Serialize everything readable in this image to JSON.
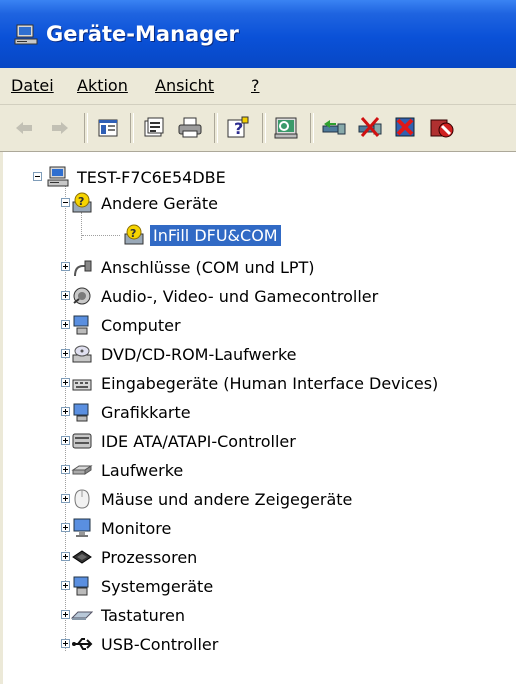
{
  "window": {
    "title": "Geräte-Manager",
    "title_bar_color": "#0a51d8"
  },
  "menu": {
    "items": [
      {
        "label": "Datei",
        "accel_key": "D"
      },
      {
        "label": "Aktion",
        "accel_key": "k"
      },
      {
        "label": "Ansicht",
        "accel_key": "A"
      },
      {
        "label": "?",
        "accel_key": "?"
      }
    ]
  },
  "toolbar": {
    "buttons": [
      {
        "icon": "back-arrow-icon",
        "enabled": false
      },
      {
        "icon": "forward-arrow-icon",
        "enabled": false
      },
      {
        "icon": "console-tree-icon",
        "enabled": true
      },
      {
        "icon": "properties-icon",
        "enabled": true
      },
      {
        "icon": "print-icon",
        "enabled": true
      },
      {
        "icon": "help-icon",
        "enabled": true
      },
      {
        "icon": "scan-hardware-icon",
        "enabled": true
      },
      {
        "icon": "update-driver-icon",
        "enabled": true
      },
      {
        "icon": "uninstall-icon",
        "enabled": true
      },
      {
        "icon": "disable-device-icon",
        "enabled": true
      }
    ]
  },
  "tree": {
    "root": {
      "label": "TEST-F7C6E54DBE",
      "icon": "computer-icon",
      "expanded": true
    },
    "categories": [
      {
        "label": "Andere Geräte",
        "icon": "unknown-device-icon",
        "expanded": true,
        "children": [
          {
            "label": "InFill DFU&COM",
            "icon": "unknown-device-icon",
            "selected": true
          }
        ]
      },
      {
        "label": "Anschlüsse (COM und LPT)",
        "icon": "port-icon",
        "expanded": false
      },
      {
        "label": "Audio-, Video- und Gamecontroller",
        "icon": "audio-icon",
        "expanded": false
      },
      {
        "label": "Computer",
        "icon": "computer-icon",
        "expanded": false
      },
      {
        "label": "DVD/CD-ROM-Laufwerke",
        "icon": "cdrom-icon",
        "expanded": false
      },
      {
        "label": "Eingabegeräte (Human Interface Devices)",
        "icon": "hid-icon",
        "expanded": false
      },
      {
        "label": "Grafikkarte",
        "icon": "display-adapter-icon",
        "expanded": false
      },
      {
        "label": "IDE ATA/ATAPI-Controller",
        "icon": "ide-controller-icon",
        "expanded": false
      },
      {
        "label": "Laufwerke",
        "icon": "disk-drive-icon",
        "expanded": false
      },
      {
        "label": "Mäuse und andere Zeigegeräte",
        "icon": "mouse-icon",
        "expanded": false
      },
      {
        "label": "Monitore",
        "icon": "monitor-icon",
        "expanded": false
      },
      {
        "label": "Prozessoren",
        "icon": "processor-icon",
        "expanded": false
      },
      {
        "label": "Systemgeräte",
        "icon": "system-device-icon",
        "expanded": false
      },
      {
        "label": "Tastaturen",
        "icon": "keyboard-icon",
        "expanded": false
      },
      {
        "label": "USB-Controller",
        "icon": "usb-icon",
        "expanded": false
      }
    ]
  },
  "colors": {
    "selection": "#316ac5",
    "chrome": "#ece9d8"
  }
}
